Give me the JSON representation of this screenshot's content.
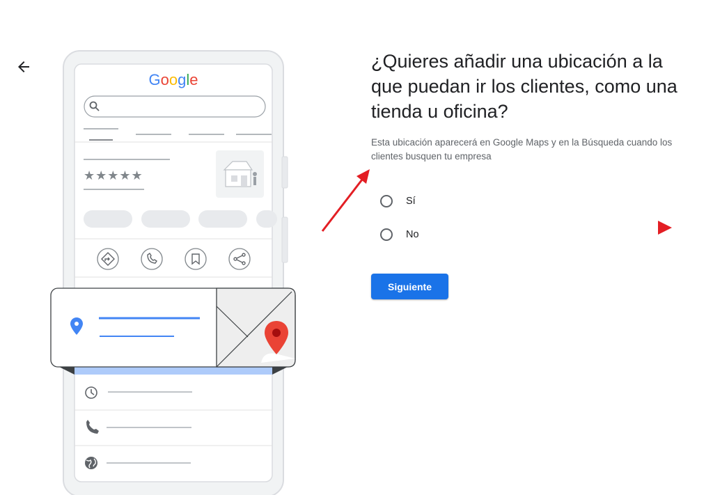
{
  "header": {
    "back_icon": "arrow-back-icon"
  },
  "illustration": {
    "logo_letters": [
      {
        "ch": "G",
        "color": "#4285F4"
      },
      {
        "ch": "o",
        "color": "#EA4335"
      },
      {
        "ch": "o",
        "color": "#FBBC05"
      },
      {
        "ch": "g",
        "color": "#4285F4"
      },
      {
        "ch": "l",
        "color": "#34A853"
      },
      {
        "ch": "e",
        "color": "#EA4335"
      }
    ],
    "rating_stars": "★★★★★",
    "pin_color": "#EA4335",
    "location_icon_color": "#4285F4"
  },
  "main": {
    "title": "¿Quieres añadir una ubicación a la que puedan ir los clientes, como una tienda u oficina?",
    "subtitle": "Esta ubicación aparecerá en Google Maps y en la Búsqueda cuando los clientes busquen tu empresa",
    "options": [
      {
        "label": "Sí",
        "selected": false
      },
      {
        "label": "No",
        "selected": false
      }
    ],
    "next_label": "Siguiente"
  },
  "colors": {
    "primary": "#1a73e8",
    "annotation": "#e31e24"
  }
}
